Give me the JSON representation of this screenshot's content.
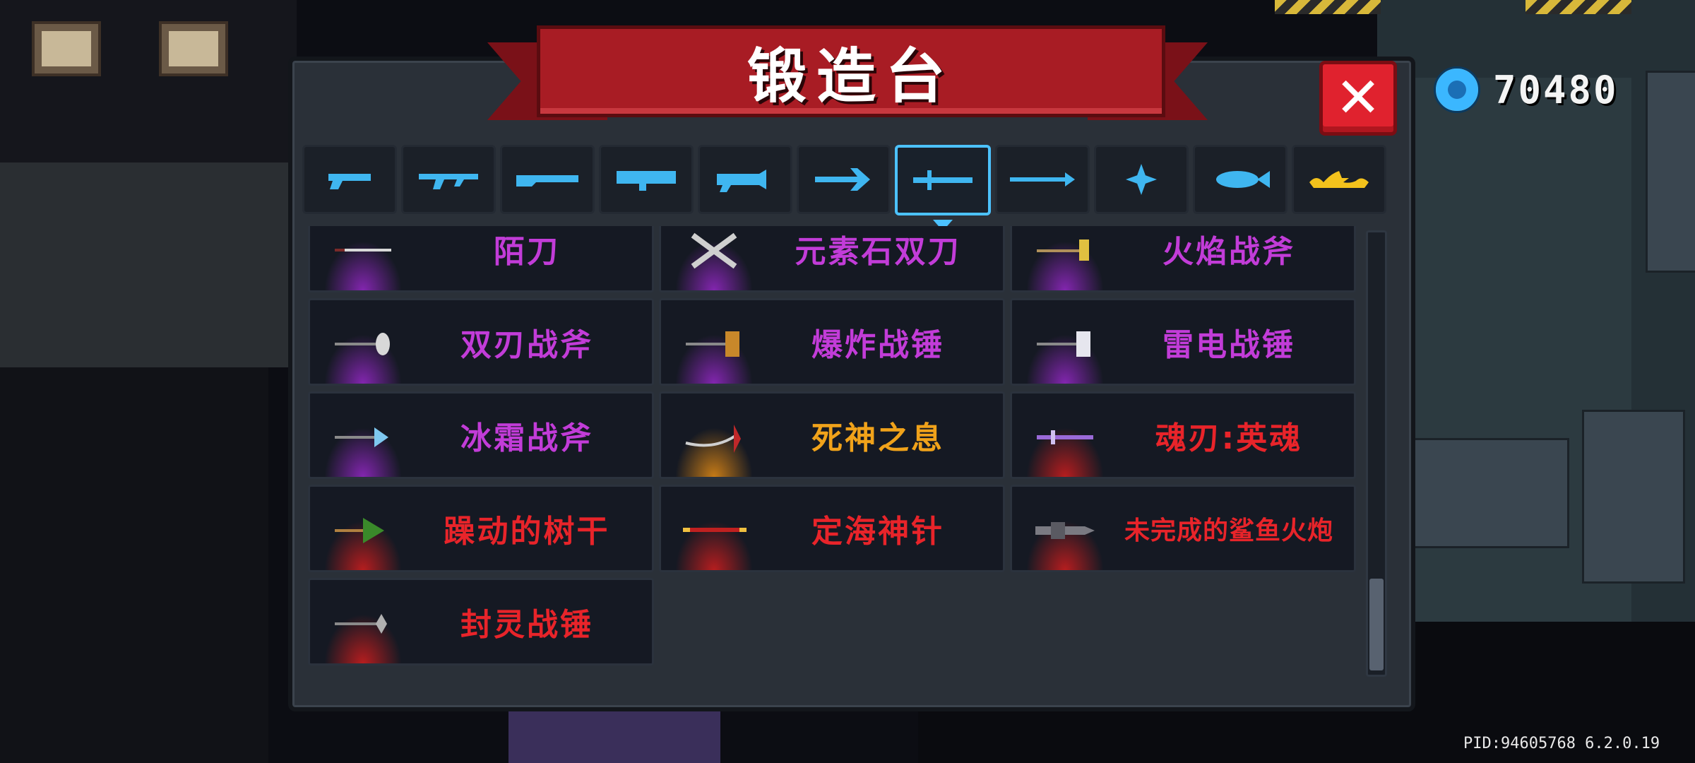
{
  "window": {
    "title": "锻造台"
  },
  "currency": {
    "icon": "gem-icon",
    "value": "70480",
    "color": "#3bb7ff"
  },
  "close": {
    "label": "✕"
  },
  "tabs": [
    {
      "name": "pistol-icon",
      "active": false
    },
    {
      "name": "rifle-icon",
      "active": false
    },
    {
      "name": "shotgun-icon",
      "active": false
    },
    {
      "name": "launcher-icon",
      "active": false
    },
    {
      "name": "laser-icon",
      "active": false
    },
    {
      "name": "bow-icon",
      "active": false
    },
    {
      "name": "sword-icon",
      "active": true
    },
    {
      "name": "spear-icon",
      "active": false
    },
    {
      "name": "shuriken-icon",
      "active": false
    },
    {
      "name": "fish-icon",
      "active": false
    },
    {
      "name": "star-icon",
      "active": false
    }
  ],
  "weapons": [
    {
      "name": "陌刀",
      "color": "#c23cd8",
      "glow": "purple",
      "icon": "blade-icon"
    },
    {
      "name": "元素石双刀",
      "color": "#c23cd8",
      "glow": "purple",
      "icon": "twin-blades-icon"
    },
    {
      "name": "火焰战斧",
      "color": "#c23cd8",
      "glow": "purple",
      "icon": "flame-axe-icon"
    },
    {
      "name": "双刃战斧",
      "color": "#c23cd8",
      "glow": "purple",
      "icon": "double-axe-icon"
    },
    {
      "name": "爆炸战锤",
      "color": "#c23cd8",
      "glow": "purple",
      "icon": "explosive-hammer-icon"
    },
    {
      "name": "雷电战锤",
      "color": "#c23cd8",
      "glow": "purple",
      "icon": "thunder-hammer-icon"
    },
    {
      "name": "冰霜战斧",
      "color": "#c23cd8",
      "glow": "purple",
      "icon": "frost-axe-icon"
    },
    {
      "name": "死神之息",
      "color": "#f0a21a",
      "glow": "orange",
      "icon": "scythe-icon"
    },
    {
      "name": "魂刃:英魂",
      "color": "#e8242a",
      "glow": "red",
      "icon": "soul-blade-icon"
    },
    {
      "name": "躁动的树干",
      "color": "#e8242a",
      "glow": "red",
      "icon": "tree-trunk-icon"
    },
    {
      "name": "定海神针",
      "color": "#e8242a",
      "glow": "red",
      "icon": "golden-staff-icon"
    },
    {
      "name": "未完成的鲨鱼火炮",
      "color": "#e8242a",
      "glow": "red",
      "icon": "shark-cannon-icon"
    },
    {
      "name": "封灵战锤",
      "color": "#e8242a",
      "glow": "red",
      "icon": "seal-hammer-icon"
    }
  ],
  "footer": {
    "pid": "PID:94605768 6.2.0.19"
  }
}
